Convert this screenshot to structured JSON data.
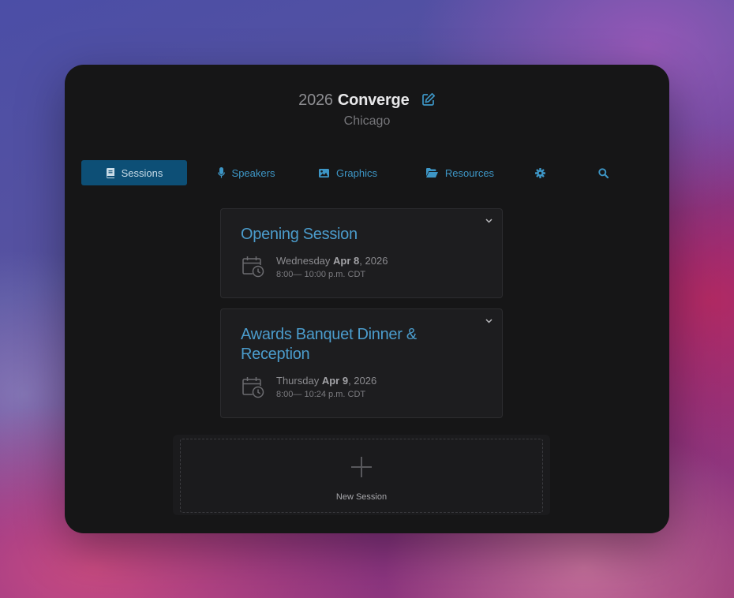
{
  "header": {
    "year": "2026",
    "name": "Converge",
    "location": "Chicago"
  },
  "tabs": [
    {
      "label": "Sessions",
      "icon": "book-icon",
      "active": true
    },
    {
      "label": "Speakers",
      "icon": "microphone-icon"
    },
    {
      "label": "Graphics",
      "icon": "image-icon"
    },
    {
      "label": "Resources",
      "icon": "folder-open-icon"
    },
    {
      "label": "",
      "icon": "gear-icon"
    },
    {
      "label": "",
      "icon": "search-icon"
    }
  ],
  "sessions": [
    {
      "title": "Opening Session",
      "weekday": "Wednesday",
      "date": "Apr 8",
      "year": ", 2026",
      "time": "8:00— 10:00 p.m. CDT"
    },
    {
      "title": "Awards Banquet Dinner & Reception",
      "weekday": "Thursday",
      "date": "Apr 9",
      "year": ", 2026",
      "time": "8:00— 10:24 p.m. CDT"
    }
  ],
  "new_session": {
    "label": "New Session"
  },
  "colors": {
    "accent": "#3d96c6",
    "active_tab": "#0d4f76",
    "panel": "#161617"
  }
}
